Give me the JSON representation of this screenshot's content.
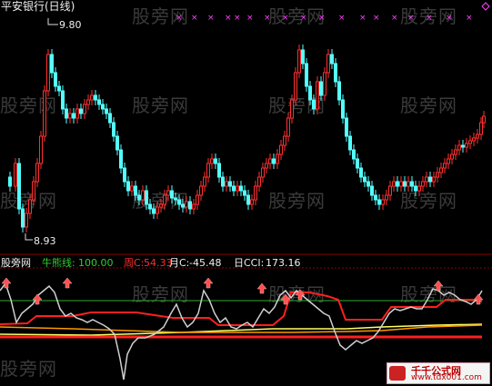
{
  "header": {
    "stock_title": "平安银行(日线)"
  },
  "price_labels": {
    "high": "9.80",
    "low": "8.93"
  },
  "indicator_bar": {
    "site": "股旁网",
    "niu_label": "牛熊线:",
    "niu_value": "100.00",
    "week_label": "周C:",
    "week_value": "54.33",
    "month_label": "月C:",
    "month_value": "-45.48",
    "day_label": "日CCI:",
    "day_value": "173.16"
  },
  "watermarks": [
    "股旁网",
    "股旁网",
    "股旁网",
    "股旁网",
    "股旁网",
    "股旁网",
    "股旁网",
    "股旁网",
    "股旁网",
    "股旁网",
    "股旁网",
    "股旁网",
    "股旁网",
    "股旁网",
    "股旁网"
  ],
  "badge": {
    "title": "千千公式网",
    "url": "www.tdx001.com"
  },
  "colors": {
    "up": "#ff3030",
    "down": "#54ffff",
    "grid": "#8b0000",
    "green_line": "#33aa33",
    "yellow_line": "#ffff66",
    "white_line": "#cfcfcf",
    "magenta": "#ff40ff"
  }
}
